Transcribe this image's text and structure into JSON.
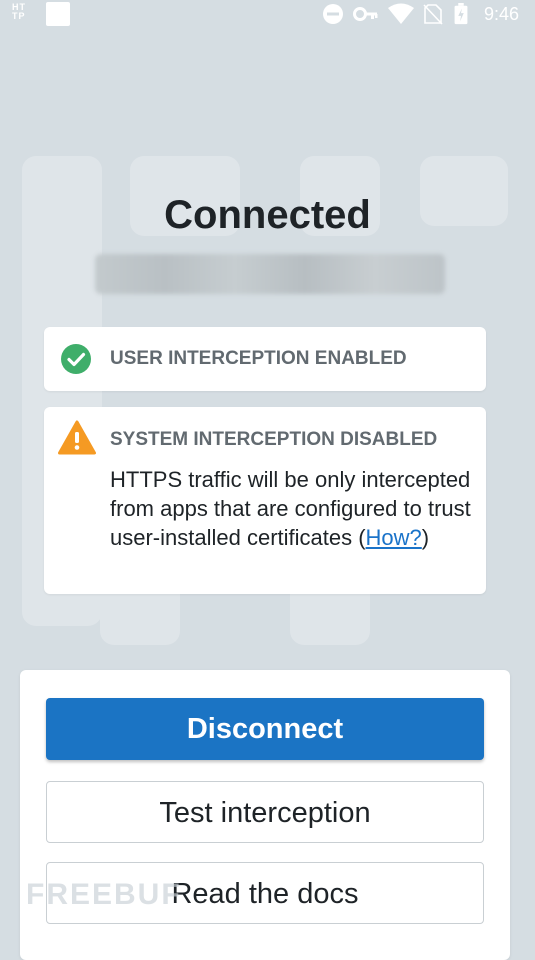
{
  "status_bar": {
    "app_logo_text": "HT\nTP",
    "time": "9:46",
    "icons": [
      "do-not-disturb-icon",
      "vpn-key-icon",
      "wifi-icon",
      "no-sim-icon",
      "battery-charging-icon"
    ]
  },
  "main": {
    "title": "Connected",
    "user_card": {
      "icon": "check-circle-icon",
      "heading": "USER INTERCEPTION ENABLED",
      "color": "#3fae6a"
    },
    "system_card": {
      "icon": "warning-icon",
      "heading": "SYSTEM INTERCEPTION DISABLED",
      "body_text": "HTTPS traffic will be only intercepted from apps that are configured to trust user-installed certificates (",
      "link_text": "How?",
      "body_suffix": ")",
      "color": "#f59a23"
    }
  },
  "actions": {
    "disconnect_label": "Disconnect",
    "test_label": "Test interception",
    "docs_label": "Read the docs",
    "accent": "#1b74c4"
  },
  "watermark": {
    "text": "FREEBUF"
  }
}
